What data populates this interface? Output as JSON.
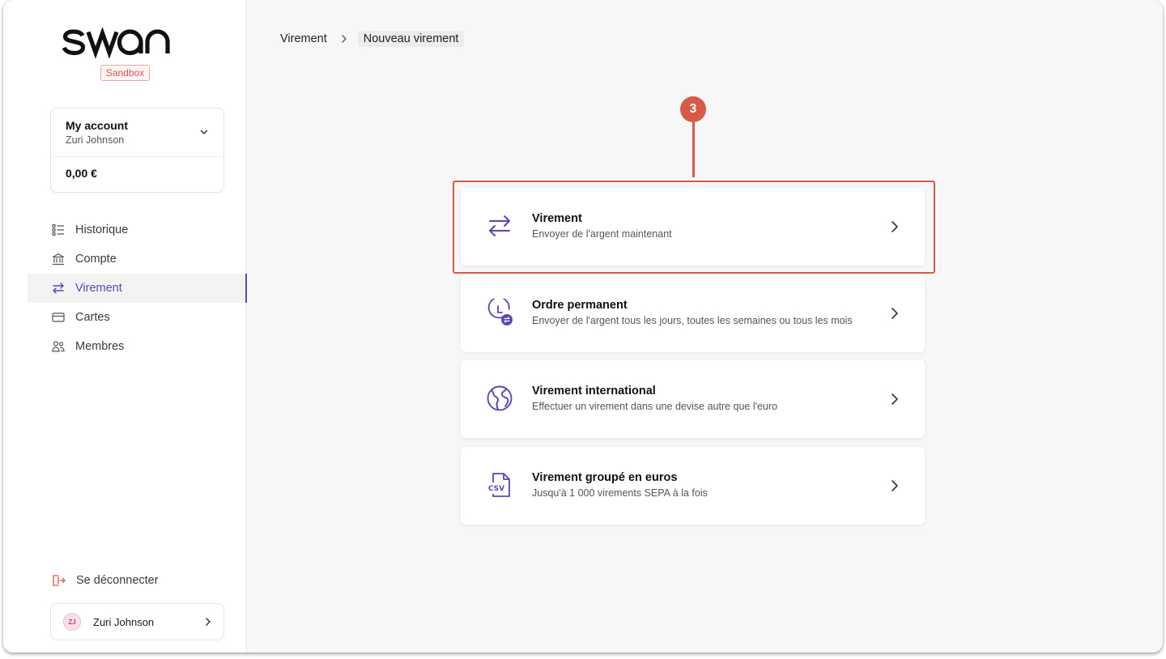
{
  "brand": {
    "logo_text": "swan",
    "env_badge": "Sandbox"
  },
  "account": {
    "name": "My account",
    "holder": "Zuri Johnson",
    "balance": "0,00 €"
  },
  "nav": {
    "items": [
      {
        "label": "Historique",
        "icon": "list-icon"
      },
      {
        "label": "Compte",
        "icon": "bank-icon"
      },
      {
        "label": "Virement",
        "icon": "transfer-arrows-icon",
        "active": true
      },
      {
        "label": "Cartes",
        "icon": "card-icon"
      },
      {
        "label": "Membres",
        "icon": "members-icon"
      }
    ]
  },
  "logout": {
    "label": "Se déconnecter"
  },
  "user": {
    "initials": "ZJ",
    "name": "Zuri Johnson"
  },
  "breadcrumb": {
    "parent": "Virement",
    "current": "Nouveau virement"
  },
  "annotation": {
    "step": "3"
  },
  "options": [
    {
      "title": "Virement",
      "description": "Envoyer de l'argent maintenant",
      "icon": "transfer-arrows-icon"
    },
    {
      "title": "Ordre permanent",
      "description": "Envoyer de l'argent tous les jours, toutes les semaines ou tous les mois",
      "icon": "recurring-clock-icon"
    },
    {
      "title": "Virement international",
      "description": "Effectuer un virement dans une devise autre que l'euro",
      "icon": "globe-icon"
    },
    {
      "title": "Virement groupé en euros",
      "description": "Jusqu'à 1 000 virements SEPA à la fois",
      "icon": "csv-file-icon"
    }
  ],
  "colors": {
    "accent": "#5a45b6",
    "annotation": "#d65a47",
    "danger": "#d9534f",
    "background": "#f7f7f7"
  }
}
